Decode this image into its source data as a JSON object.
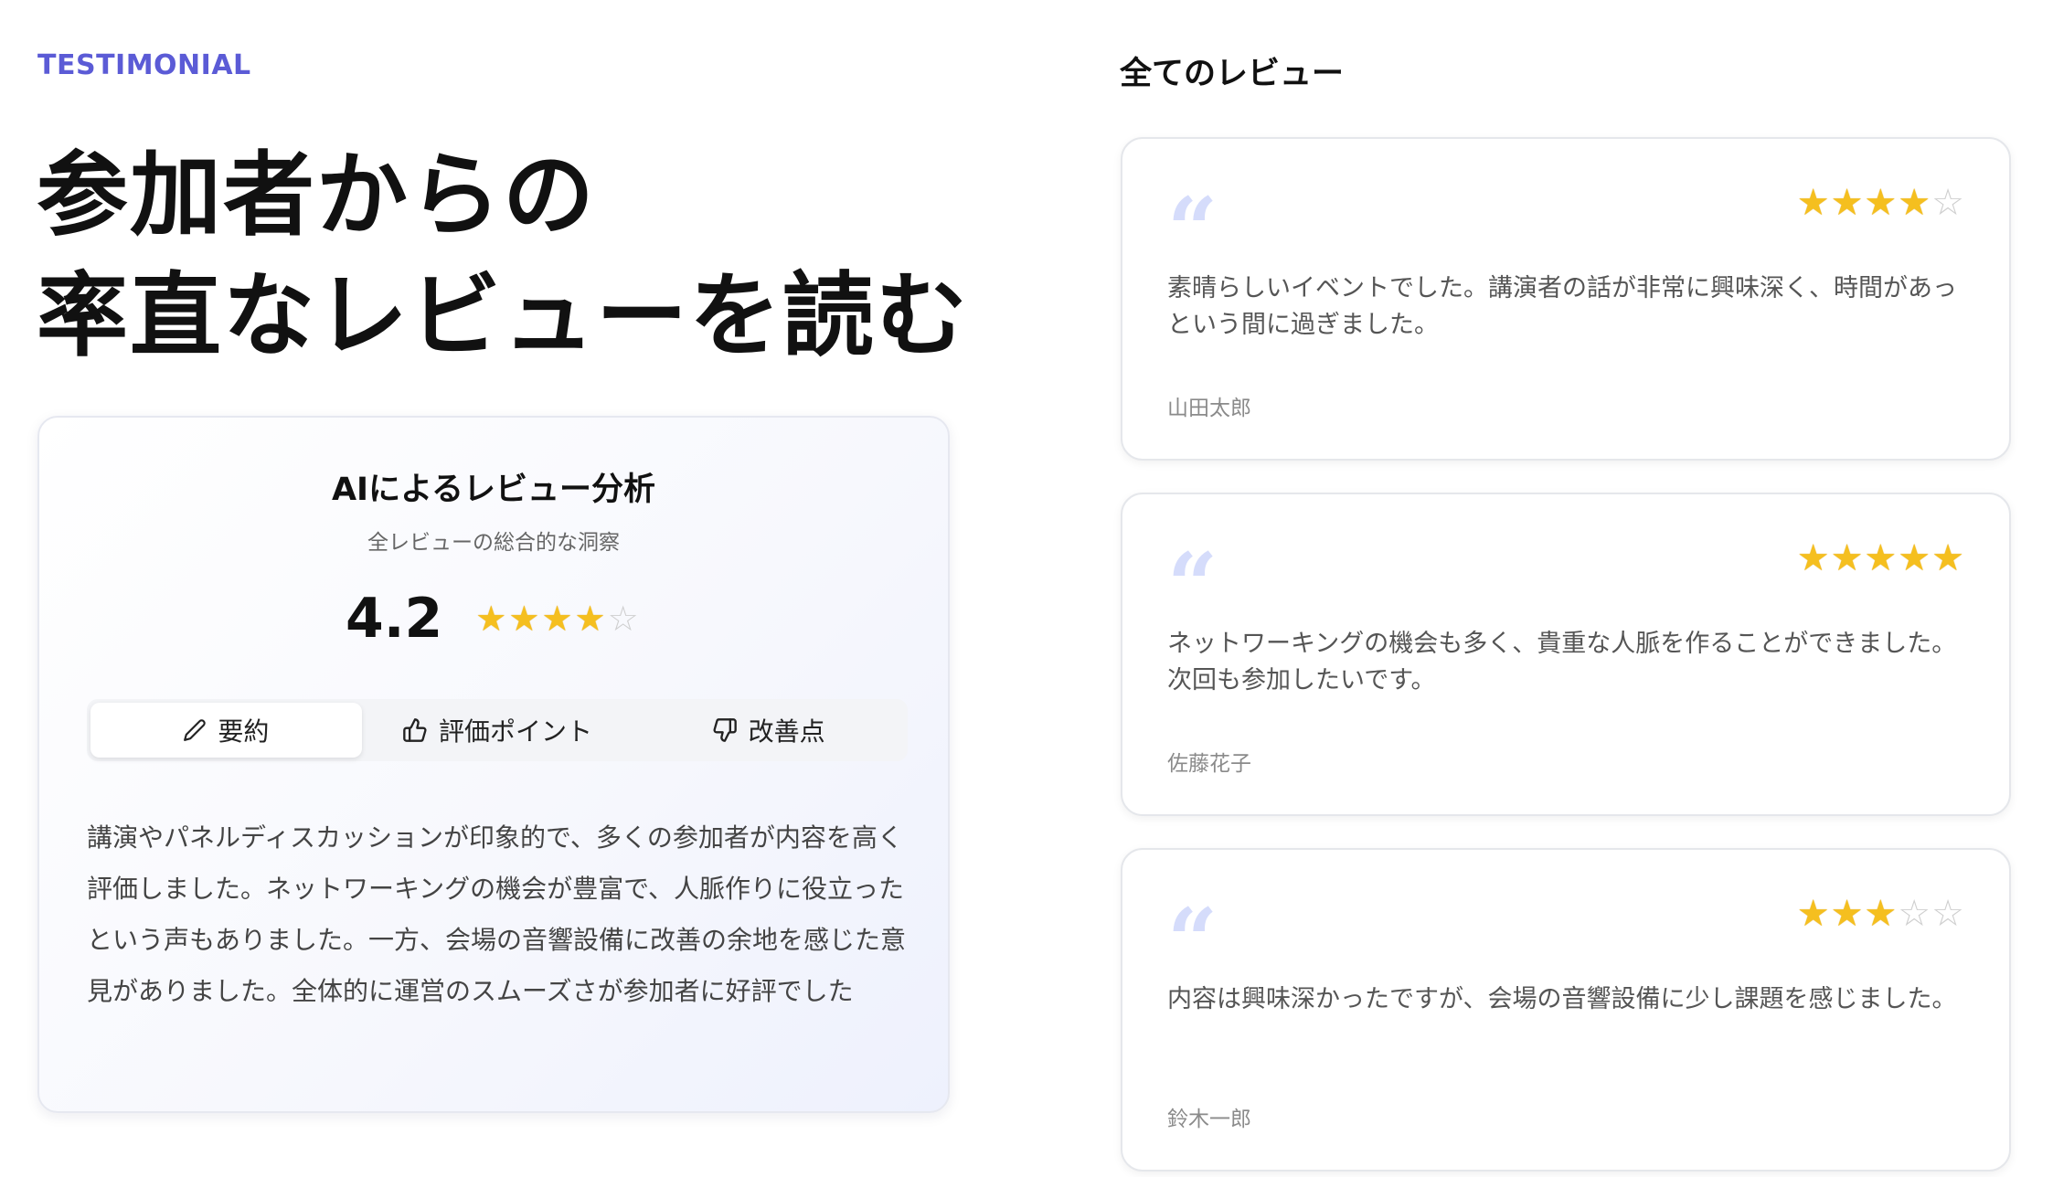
{
  "eyebrow": "TESTIMONIAL",
  "headline": {
    "line1": "参加者からの",
    "line2": "率直なレビューを読む"
  },
  "ai_analysis": {
    "title": "AIによるレビュー分析",
    "subtitle": "全レビューの総合的な洞察",
    "score": "4.2",
    "score_stars": 4,
    "tabs": [
      {
        "label": "要約",
        "icon": "pencil-icon",
        "active": true
      },
      {
        "label": "評価ポイント",
        "icon": "thumbs-up-icon",
        "active": false
      },
      {
        "label": "改善点",
        "icon": "thumbs-down-icon",
        "active": false
      }
    ],
    "summary": "講演やパネルディスカッションが印象的で、多くの参加者が内容を高く評価しました。ネットワーキングの機会が豊富で、人脈作りに役立ったという声もありました。一方、会場の音響設備に改善の余地を感じた意見がありました。全体的に運営のスムーズさが参加者に好評でした"
  },
  "reviews_heading": "全てのレビュー",
  "reviews": [
    {
      "rating": 4,
      "text": "素晴らしいイベントでした。講演者の話が非常に興味深く、時間があっという間に過ぎました。",
      "author": "山田太郎"
    },
    {
      "rating": 5,
      "text": "ネットワーキングの機会も多く、貴重な人脈を作ることができました。次回も参加したいです。",
      "author": "佐藤花子"
    },
    {
      "rating": 3,
      "text": "内容は興味深かったですが、会場の音響設備に少し課題を感じました。",
      "author": "鈴木一郎"
    }
  ],
  "colors": {
    "accent": "#5b5bd6",
    "star": "#f5bf1f",
    "quote": "#d5dcfb"
  }
}
